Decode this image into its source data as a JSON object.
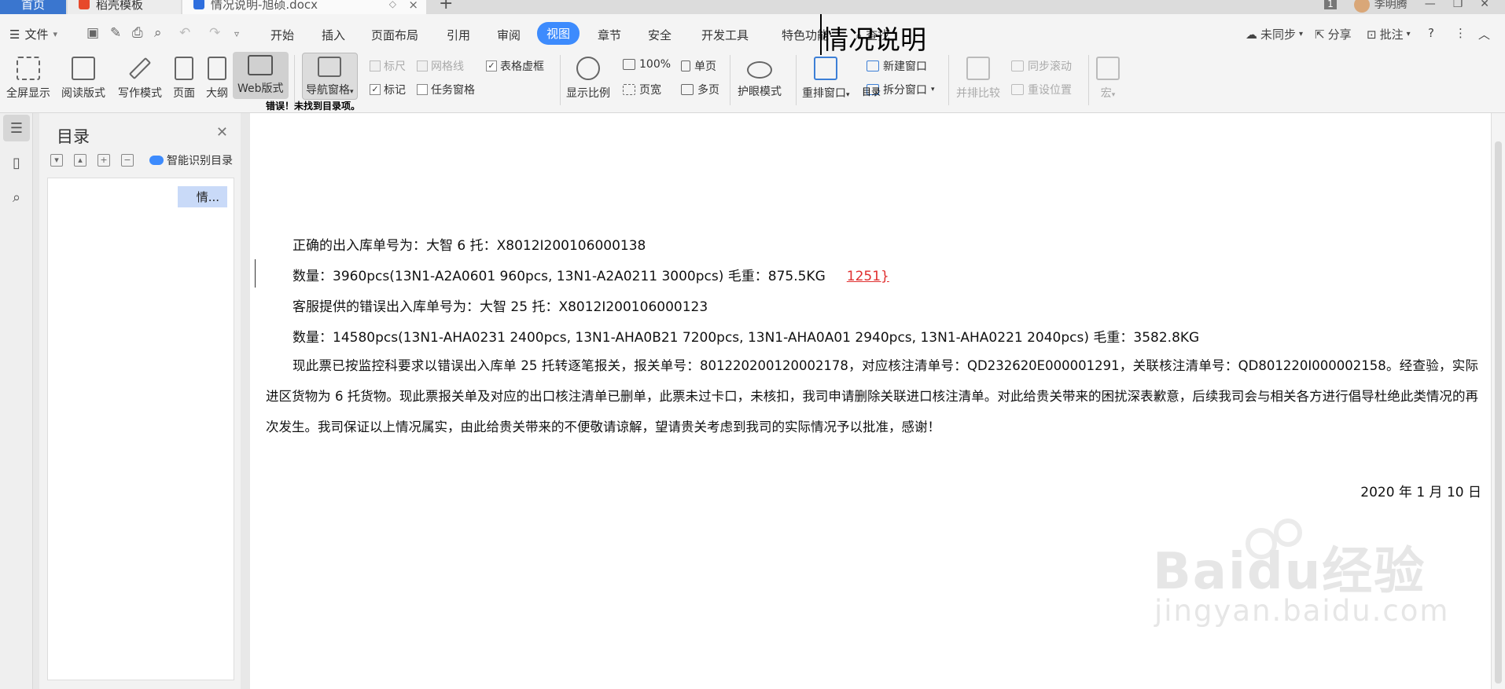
{
  "tabs": {
    "home": "首页",
    "docer": "稻壳模板",
    "doc": "情况说明-旭硕.docx",
    "add": "+",
    "close": "×"
  },
  "tabbar_right": {
    "count": "1",
    "user": "李明腾"
  },
  "menu": {
    "file": "文件",
    "tabs": [
      "开始",
      "插入",
      "页面布局",
      "引用",
      "审阅",
      "视图",
      "章节",
      "安全",
      "开发工具",
      "特色功能"
    ],
    "active_tab": "视图",
    "search": "查找",
    "sync": "未同步",
    "share": "分享",
    "comment": "批注"
  },
  "ribbon": {
    "fullscreen": "全屏显示",
    "read": "阅读版式",
    "write": "写作模式",
    "page": "页面",
    "outline": "大纲",
    "web": "Web版式",
    "nav": "导航窗格",
    "ruler": "标尺",
    "gridlines": "网格线",
    "table_gridlines": "表格虚框",
    "marks": "标记",
    "task_pane": "任务窗格",
    "zoom": "显示比例",
    "zoom100": "100%",
    "page_width": "页宽",
    "single_page": "单页",
    "multi_page": "多页",
    "eye_mode": "护眼模式",
    "rearrange": "重排窗口",
    "new_window": "新建窗口",
    "split": "拆分窗口",
    "compare": "并排比较",
    "sync_scroll": "同步滚动",
    "reset_pos": "重设位置",
    "macro": "宏"
  },
  "nav_pane": {
    "title": "目录",
    "smart": "智能识别目录",
    "item": "情..."
  },
  "document": {
    "title": "情况说明",
    "toc_heading": "目录",
    "toc_error": "错误！未找到目录项。",
    "line1": "正确的出入库单号为：大智 6 托：X8012I200106000138",
    "line2a": "数量：3960pcs(13N1-A2A0601 960pcs, 13N1-A2A0211 3000pcs)     毛重：875.5KG",
    "line2b": "1251}",
    "line3": "客服提供的错误出入库单号为：大智 25 托：X8012I200106000123",
    "line4": "数量：14580pcs(13N1-AHA0231 2400pcs, 13N1-AHA0B21 7200pcs, 13N1-AHA0A01 2940pcs, 13N1-AHA0221 2040pcs)          毛重：3582.8KG",
    "paragraph": "现此票已按监控科要求以错误出入库单 25 托转逐笔报关，报关单号：801220200120002178，对应核注清单号：QD232620E000001291，关联核注清单号：QD801220I000002158。经查验，实际进区货物为 6 托货物。现此票报关单及对应的出口核注清单已删单，此票未过卡口，未核扣，我司申请删除关联进口核注清单。对此给贵关带来的困扰深表歉意，后续我司会与相关各方进行倡导杜绝此类情况的再次发生。我司保证以上情况属实，由此给贵关带来的不便敬请谅解，望请贵关考虑到我司的实际情况予以批准，感谢！",
    "date": "2020 年 1 月 10 日"
  },
  "watermark": {
    "brand": "Baidu经验",
    "url": "jingyan.baidu.com"
  }
}
